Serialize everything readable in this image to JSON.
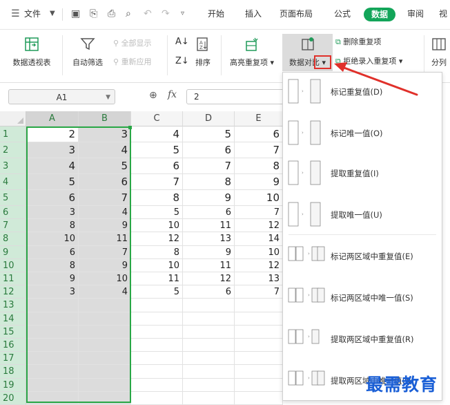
{
  "menubar": {
    "file_label": "文件",
    "tabs": [
      "开始",
      "插入",
      "页面布局",
      "公式",
      "数据",
      "审阅",
      "视"
    ],
    "active_tab": "数据"
  },
  "ribbon": {
    "pivot": "数据透视表",
    "autofilter": "自动筛选",
    "show_all": "全部显示",
    "reapply": "重新应用",
    "sort": "排序",
    "highlight_dup": "高亮重复项",
    "compare": "数据对比",
    "remove_dup": "删除重复项",
    "reject_dup": "拒绝录入重复项",
    "split": "分列"
  },
  "formula_bar": {
    "name_box": "A1",
    "fx": "fx",
    "value": "2"
  },
  "sheet": {
    "columns": [
      "A",
      "B",
      "C",
      "D",
      "E"
    ],
    "rows": [
      [
        "2",
        "3",
        "4",
        "5",
        "6"
      ],
      [
        "3",
        "4",
        "5",
        "6",
        "7"
      ],
      [
        "4",
        "5",
        "6",
        "7",
        "8"
      ],
      [
        "5",
        "6",
        "7",
        "8",
        "9"
      ],
      [
        "6",
        "7",
        "8",
        "9",
        "10"
      ],
      [
        "3",
        "4",
        "5",
        "6",
        "7"
      ],
      [
        "8",
        "9",
        "10",
        "11",
        "12"
      ],
      [
        "10",
        "11",
        "12",
        "13",
        "14"
      ],
      [
        "6",
        "7",
        "8",
        "9",
        "10"
      ],
      [
        "8",
        "9",
        "10",
        "11",
        "12"
      ],
      [
        "9",
        "10",
        "11",
        "12",
        "13"
      ],
      [
        "3",
        "4",
        "5",
        "6",
        "7"
      ],
      [
        "",
        "",
        "",
        "",
        ""
      ],
      [
        "",
        "",
        "",
        "",
        ""
      ],
      [
        "",
        "",
        "",
        "",
        ""
      ],
      [
        "",
        "",
        "",
        "",
        ""
      ],
      [
        "",
        "",
        "",
        "",
        ""
      ],
      [
        "",
        "",
        "",
        "",
        ""
      ],
      [
        "",
        "",
        "",
        "",
        ""
      ],
      [
        "",
        "",
        "",
        "",
        ""
      ]
    ],
    "row_numbers": [
      "1",
      "2",
      "3",
      "4",
      "5",
      "6",
      "7",
      "8",
      "9",
      "10",
      "11",
      "12",
      "13",
      "14",
      "15",
      "16",
      "17",
      "18",
      "19",
      "20"
    ]
  },
  "dropdown": {
    "items": [
      "标记重复值(D)",
      "标记唯一值(O)",
      "提取重复值(I)",
      "提取唯一值(U)",
      "标记两区域中重复值(E)",
      "标记两区域中唯一值(S)",
      "提取两区域中重复值(R)",
      "提取两区域中唯一值(N)"
    ]
  },
  "watermark": "最需教育",
  "colors": {
    "accent": "#13a559",
    "selection": "#28a745",
    "annotation": "#e0302a"
  }
}
